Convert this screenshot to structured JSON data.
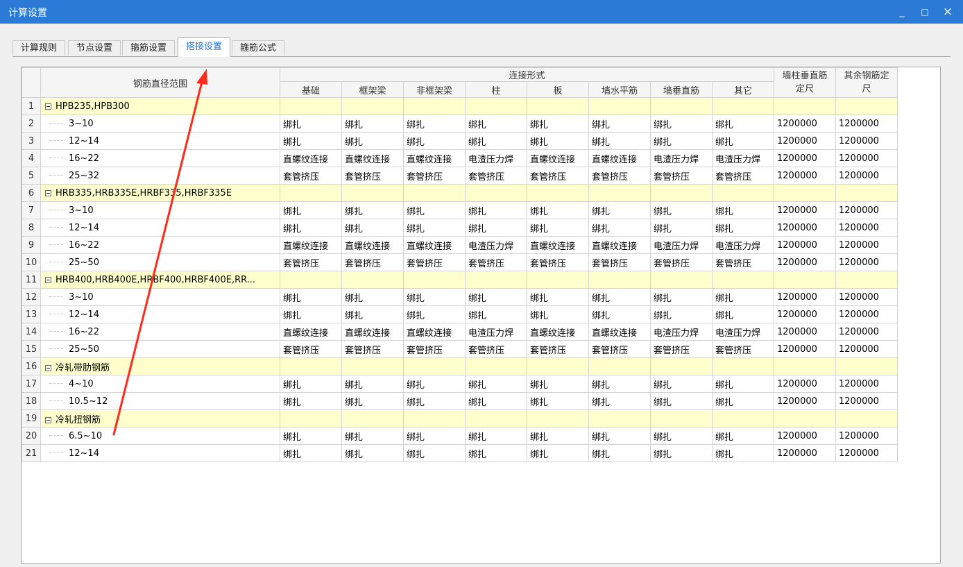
{
  "window": {
    "title": "计算设置",
    "minimize": "_",
    "maximize": "□",
    "close": "×"
  },
  "tabs": [
    {
      "label": "计算规则",
      "active": false
    },
    {
      "label": "节点设置",
      "active": false
    },
    {
      "label": "箍筋设置",
      "active": false
    },
    {
      "label": "搭接设置",
      "active": true
    },
    {
      "label": "箍筋公式",
      "active": false
    }
  ],
  "table": {
    "header": {
      "range": "钢筋直径范围",
      "group": "连接形式",
      "subcols": [
        "基础",
        "框架梁",
        "非框架梁",
        "柱",
        "板",
        "墙水平筋",
        "墙垂直筋",
        "其它"
      ],
      "col_wall_line1": "墙柱垂直筋",
      "col_wall_line2": "定尺",
      "col_other_line1": "其余钢筋定",
      "col_other_line2": "尺"
    },
    "rows": [
      {
        "n": "1",
        "type": "group",
        "label": "HPB235,HPB300"
      },
      {
        "n": "2",
        "type": "item",
        "label": "3~10",
        "vals": [
          "绑扎",
          "绑扎",
          "绑扎",
          "绑扎",
          "绑扎",
          "绑扎",
          "绑扎",
          "绑扎",
          "1200000",
          "1200000"
        ]
      },
      {
        "n": "3",
        "type": "item",
        "label": "12~14",
        "vals": [
          "绑扎",
          "绑扎",
          "绑扎",
          "绑扎",
          "绑扎",
          "绑扎",
          "绑扎",
          "绑扎",
          "1200000",
          "1200000"
        ]
      },
      {
        "n": "4",
        "type": "item",
        "label": "16~22",
        "vals": [
          "直螺纹连接",
          "直螺纹连接",
          "直螺纹连接",
          "电渣压力焊",
          "直螺纹连接",
          "直螺纹连接",
          "电渣压力焊",
          "电渣压力焊",
          "1200000",
          "1200000"
        ]
      },
      {
        "n": "5",
        "type": "item",
        "label": "25~32",
        "vals": [
          "套管挤压",
          "套管挤压",
          "套管挤压",
          "套管挤压",
          "套管挤压",
          "套管挤压",
          "套管挤压",
          "套管挤压",
          "1200000",
          "1200000"
        ]
      },
      {
        "n": "6",
        "type": "group",
        "label": "HRB335,HRB335E,HRBF335,HRBF335E"
      },
      {
        "n": "7",
        "type": "item",
        "label": "3~10",
        "vals": [
          "绑扎",
          "绑扎",
          "绑扎",
          "绑扎",
          "绑扎",
          "绑扎",
          "绑扎",
          "绑扎",
          "1200000",
          "1200000"
        ]
      },
      {
        "n": "8",
        "type": "item",
        "label": "12~14",
        "vals": [
          "绑扎",
          "绑扎",
          "绑扎",
          "绑扎",
          "绑扎",
          "绑扎",
          "绑扎",
          "绑扎",
          "1200000",
          "1200000"
        ]
      },
      {
        "n": "9",
        "type": "item",
        "label": "16~22",
        "vals": [
          "直螺纹连接",
          "直螺纹连接",
          "直螺纹连接",
          "电渣压力焊",
          "直螺纹连接",
          "直螺纹连接",
          "电渣压力焊",
          "电渣压力焊",
          "1200000",
          "1200000"
        ]
      },
      {
        "n": "10",
        "type": "item",
        "label": "25~50",
        "vals": [
          "套管挤压",
          "套管挤压",
          "套管挤压",
          "套管挤压",
          "套管挤压",
          "套管挤压",
          "套管挤压",
          "套管挤压",
          "1200000",
          "1200000"
        ]
      },
      {
        "n": "11",
        "type": "group",
        "label": "HRB400,HRB400E,HRBF400,HRBF400E,RR..."
      },
      {
        "n": "12",
        "type": "item",
        "label": "3~10",
        "vals": [
          "绑扎",
          "绑扎",
          "绑扎",
          "绑扎",
          "绑扎",
          "绑扎",
          "绑扎",
          "绑扎",
          "1200000",
          "1200000"
        ]
      },
      {
        "n": "13",
        "type": "item",
        "label": "12~14",
        "vals": [
          "绑扎",
          "绑扎",
          "绑扎",
          "绑扎",
          "绑扎",
          "绑扎",
          "绑扎",
          "绑扎",
          "1200000",
          "1200000"
        ]
      },
      {
        "n": "14",
        "type": "item",
        "label": "16~22",
        "vals": [
          "直螺纹连接",
          "直螺纹连接",
          "直螺纹连接",
          "电渣压力焊",
          "直螺纹连接",
          "直螺纹连接",
          "电渣压力焊",
          "电渣压力焊",
          "1200000",
          "1200000"
        ]
      },
      {
        "n": "15",
        "type": "item",
        "label": "25~50",
        "vals": [
          "套管挤压",
          "套管挤压",
          "套管挤压",
          "套管挤压",
          "套管挤压",
          "套管挤压",
          "套管挤压",
          "套管挤压",
          "1200000",
          "1200000"
        ]
      },
      {
        "n": "16",
        "type": "group",
        "label": "冷轧带肋钢筋"
      },
      {
        "n": "17",
        "type": "item",
        "label": "4~10",
        "vals": [
          "绑扎",
          "绑扎",
          "绑扎",
          "绑扎",
          "绑扎",
          "绑扎",
          "绑扎",
          "绑扎",
          "1200000",
          "1200000"
        ]
      },
      {
        "n": "18",
        "type": "item",
        "label": "10.5~12",
        "vals": [
          "绑扎",
          "绑扎",
          "绑扎",
          "绑扎",
          "绑扎",
          "绑扎",
          "绑扎",
          "绑扎",
          "1200000",
          "1200000"
        ]
      },
      {
        "n": "19",
        "type": "group",
        "label": "冷轧扭钢筋"
      },
      {
        "n": "20",
        "type": "item",
        "label": "6.5~10",
        "vals": [
          "绑扎",
          "绑扎",
          "绑扎",
          "绑扎",
          "绑扎",
          "绑扎",
          "绑扎",
          "绑扎",
          "1200000",
          "1200000"
        ]
      },
      {
        "n": "21",
        "type": "item",
        "label": "12~14",
        "vals": [
          "绑扎",
          "绑扎",
          "绑扎",
          "绑扎",
          "绑扎",
          "绑扎",
          "绑扎",
          "绑扎",
          "1200000",
          "1200000"
        ]
      }
    ]
  },
  "colors": {
    "titlebar": "#2b7bd6",
    "active_tab_text": "#2a79d2",
    "group_row": "#ffffcd",
    "annotation_arrow": "#ff2a1a"
  }
}
